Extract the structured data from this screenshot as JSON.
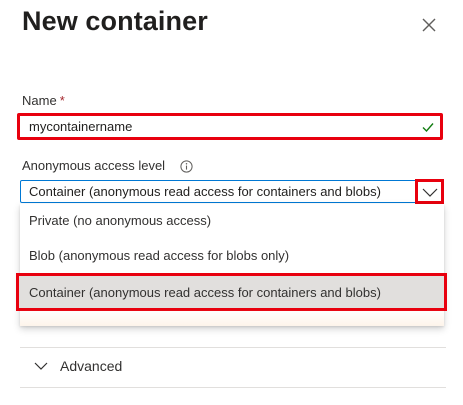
{
  "panel": {
    "title": "New container"
  },
  "name_field": {
    "label": "Name",
    "required_marker": "*",
    "value": "mycontainername",
    "validation": "check-icon"
  },
  "access_field": {
    "label": "Anonymous access level",
    "selected_value": "Container (anonymous read access for containers and blobs)",
    "options": [
      {
        "label": "Private (no anonymous access)"
      },
      {
        "label": "Blob (anonymous read access for blobs only)"
      },
      {
        "label": "Container (anonymous read access for containers and blobs)"
      }
    ]
  },
  "advanced": {
    "label": "Advanced"
  },
  "colors": {
    "highlight_border": "#e8000e",
    "focus_border": "#0078d4",
    "valid_check": "#107c10",
    "required": "#a4262c",
    "selected_option_bg": "#e1dfdd"
  },
  "icons": {
    "close": "close-icon",
    "info": "info-icon",
    "dropdown": "chevron-down-icon",
    "advanced": "chevron-down-icon"
  }
}
